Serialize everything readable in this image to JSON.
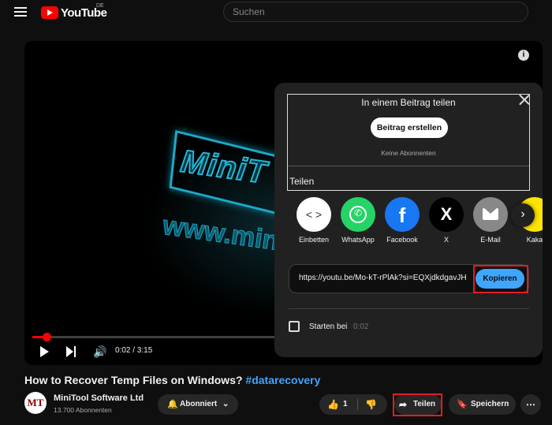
{
  "header": {
    "logo_text": "YouTube",
    "logo_region": "DE",
    "search_placeholder": "Suchen"
  },
  "player": {
    "overlay_text_1": "MiniT",
    "overlay_text_2": "www.min",
    "time": "0:02 / 3:15",
    "progress_fraction": 0.02
  },
  "share_dialog": {
    "post_title": "In einem Beitrag teilen",
    "post_button": "Beitrag erstellen",
    "post_sub": "Keine Abonnenten",
    "share_label": "Teilen",
    "options": [
      {
        "label": "Einbetten",
        "icon": "embed-icon"
      },
      {
        "label": "WhatsApp",
        "icon": "whatsapp-icon"
      },
      {
        "label": "Facebook",
        "icon": "facebook-icon"
      },
      {
        "label": "X",
        "icon": "x-icon"
      },
      {
        "label": "E-Mail",
        "icon": "email-icon"
      },
      {
        "label": "Kaka",
        "icon": "kakao-icon"
      }
    ],
    "url": "https://youtu.be/Mo-kT-rPlAk?si=EQXjdkdgavJH",
    "copy_button": "Kopieren",
    "start_label": "Starten bei",
    "start_time": "0:02"
  },
  "video": {
    "title": "How to Recover Temp Files on Windows?",
    "hashtag": "#datarecovery"
  },
  "channel": {
    "avatar_text": "MT",
    "name": "MiniTool Software Ltd",
    "subscribers": "13.700 Abonnenten"
  },
  "actions": {
    "subscribe_label": "Abonniert",
    "like_count": "1",
    "share_label": "Teilen",
    "save_label": "Speichern",
    "more_label": "⋯"
  },
  "colors": {
    "accent": "#3ea6ff",
    "brand_red": "#ff0000",
    "highlight_red": "#e31b23"
  }
}
